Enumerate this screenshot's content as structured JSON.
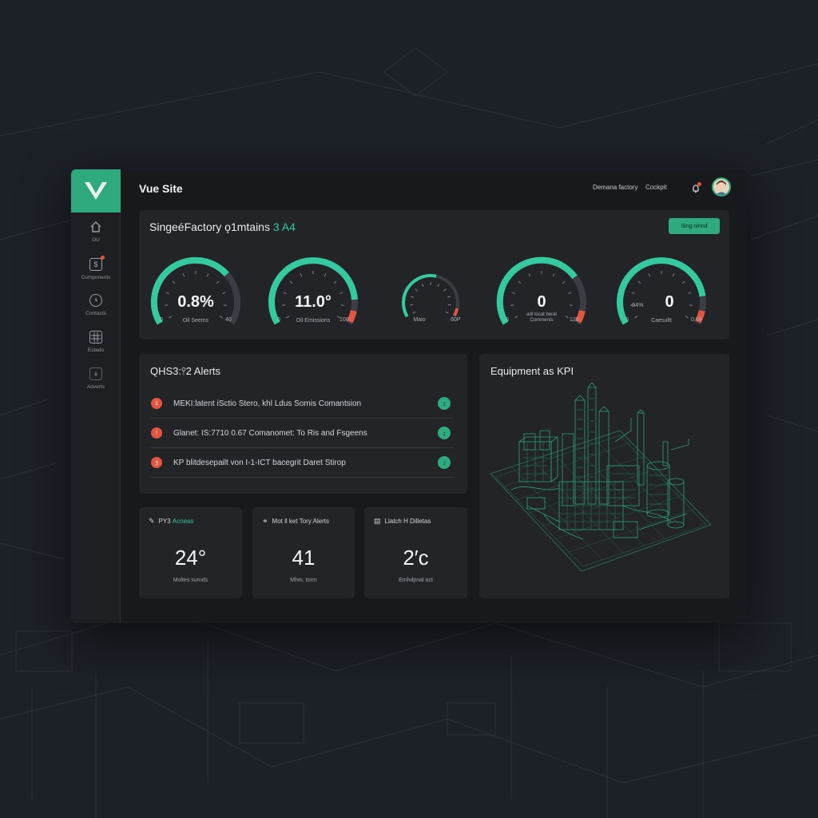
{
  "app": {
    "site_title": "Vue Site"
  },
  "topbar": {
    "links": [
      "Demana factory",
      "Cockpit"
    ]
  },
  "sidebar": {
    "items": [
      {
        "label": "OU",
        "icon": "home-icon"
      },
      {
        "label": "Components",
        "icon": "component-icon"
      },
      {
        "label": "Contacts",
        "icon": "clock-icon"
      },
      {
        "label": "Estado",
        "icon": "grid-icon"
      },
      {
        "label": "Adverts",
        "icon": "archive-icon"
      }
    ]
  },
  "gauges_panel": {
    "title": "SingeéFactory ǫ1mtains",
    "title_accent": "3 A4",
    "button_label": "Sing ninnd",
    "gauges": [
      {
        "value": "0.8%",
        "label": "Oil Seems",
        "min": "0",
        "max": "40",
        "level": 0.7,
        "red": false
      },
      {
        "value": "11.0°",
        "label": "Oil Emissions",
        "min": "0",
        "max": "100",
        "level": 0.86,
        "red": true
      },
      {
        "value": "",
        "label": "Maio",
        "min": "",
        "max": "60P",
        "level": 0.55,
        "red": true
      },
      {
        "value": "0",
        "sub": "adl tocat beral\nComments",
        "min": "0",
        "max": "120",
        "level": 0.72,
        "red": true
      },
      {
        "value": "0",
        "prefix": "-94%",
        "label": "Caesultt",
        "min": "0",
        "max": "0.04",
        "level": 0.84,
        "red": true
      }
    ]
  },
  "alerts_panel": {
    "title": "QHS3:⫯2 Alerts",
    "alerts": [
      {
        "badge": "1",
        "text": "MEKI:latent iSctio Stero, khl Ldus Somis Comantsion"
      },
      {
        "badge": "!",
        "text": "Glanet: IS:7710 0.67  Comanomet: To Ris and Fsgeens"
      },
      {
        "badge": "ʒ",
        "text": "KP blitdesepailt von I-1-ICT  bacegrit Daret Stirop"
      }
    ]
  },
  "stats": [
    {
      "icon": "pen-icon",
      "label": "PY3",
      "label_accent": "Acness",
      "value": "24°",
      "sub": "Moltes surnds"
    },
    {
      "icon": "link-icon",
      "label": "Mot ll ket Tory Alerts",
      "value": "41",
      "sub": "Mhm. torm"
    },
    {
      "icon": "calendar-icon",
      "label": "Llatch H Dilletas",
      "value": "2′c",
      "sub": "Emhdpnal oct"
    }
  ],
  "equipment_panel": {
    "title": "Equipment as KPI"
  },
  "colors": {
    "accent": "#2fa97e",
    "gauge": "#35c9a0",
    "alert": "#e0563f"
  }
}
